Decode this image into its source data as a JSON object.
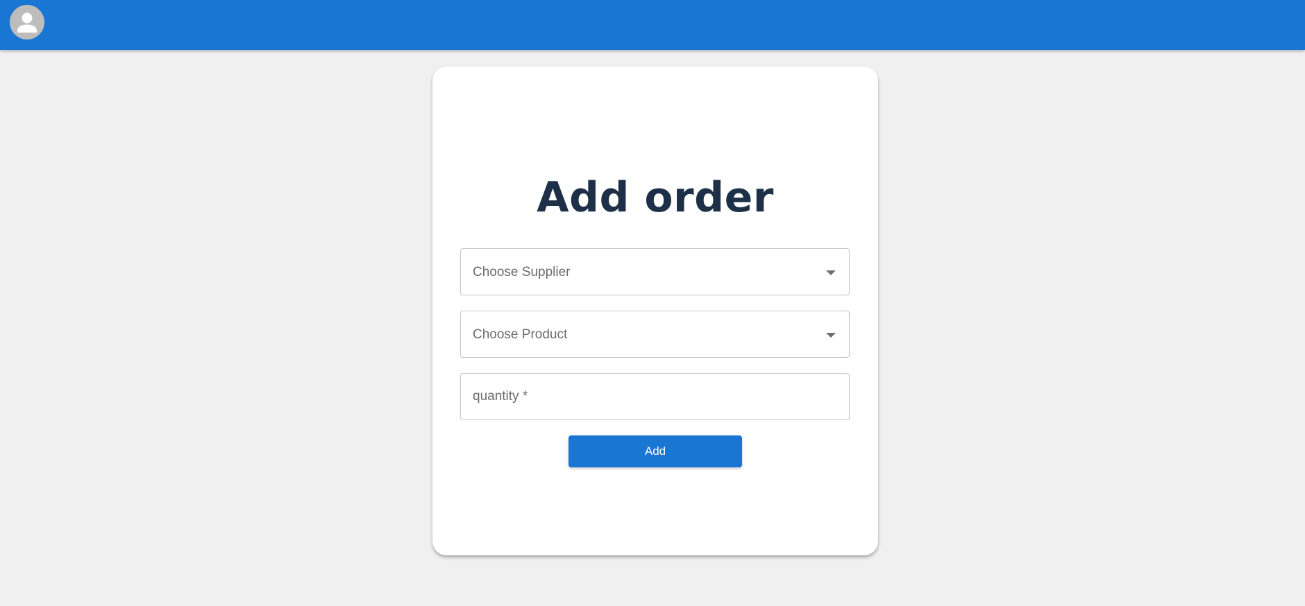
{
  "appbar": {
    "avatar_icon": "person-icon",
    "color": "#1976d2"
  },
  "form": {
    "title": "Add order",
    "supplier_select": {
      "placeholder": "Choose Supplier",
      "icon": "chevron-down-icon"
    },
    "product_select": {
      "placeholder": "Choose Product",
      "icon": "chevron-down-icon"
    },
    "quantity_input": {
      "placeholder": "quantity *",
      "value": ""
    },
    "add_button_label": "Add",
    "accent_color": "#1976d2",
    "title_color": "#1e3047"
  }
}
